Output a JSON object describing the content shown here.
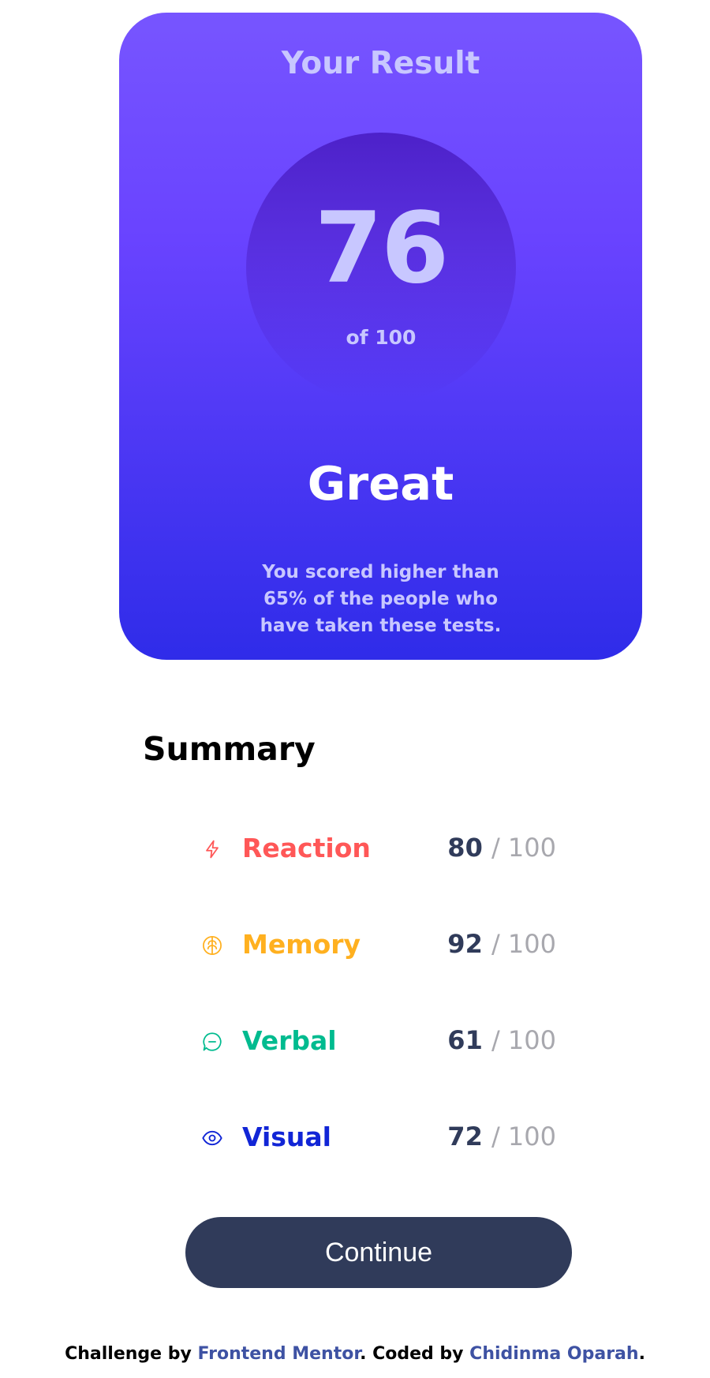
{
  "result": {
    "title": "Your Result",
    "score": "76",
    "score_of": "of 100",
    "rating": "Great",
    "description": "You scored higher than 65% of the people who have taken these tests."
  },
  "summary": {
    "title": "Summary",
    "items": [
      {
        "label": "Reaction",
        "score": "80",
        "max": "/ 100",
        "icon": "lightning-icon",
        "color": "#ff5757"
      },
      {
        "label": "Memory",
        "score": "92",
        "max": "/ 100",
        "icon": "brain-icon",
        "color": "#ffb01f"
      },
      {
        "label": "Verbal",
        "score": "61",
        "max": "/ 100",
        "icon": "chat-icon",
        "color": "#00bb8f"
      },
      {
        "label": "Visual",
        "score": "72",
        "max": "/ 100",
        "icon": "eye-icon",
        "color": "#1125d6"
      }
    ]
  },
  "continue_label": "Continue",
  "footer": {
    "challenge_prefix": "Challenge by ",
    "challenge_link": "Frontend Mentor",
    "coded_prefix": ". Coded by ",
    "coded_link": "Chidinma Oparah",
    "suffix": "."
  },
  "colors": {
    "card_gradient_top": "#7755ff",
    "card_gradient_bottom": "#2f2ce9",
    "circle_gradient_top": "#4d21c9",
    "button": "#303b5a",
    "link": "#3e52a3"
  }
}
